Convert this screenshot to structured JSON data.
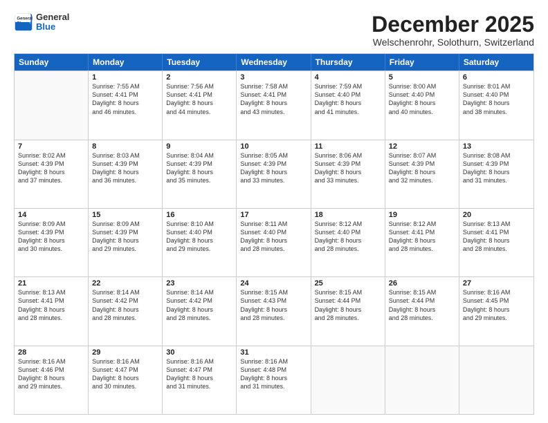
{
  "header": {
    "logo_general": "General",
    "logo_blue": "Blue",
    "month_title": "December 2025",
    "location": "Welschenrohr, Solothurn, Switzerland"
  },
  "weekdays": [
    "Sunday",
    "Monday",
    "Tuesday",
    "Wednesday",
    "Thursday",
    "Friday",
    "Saturday"
  ],
  "rows": [
    [
      {
        "day": "",
        "info": ""
      },
      {
        "day": "1",
        "info": "Sunrise: 7:55 AM\nSunset: 4:41 PM\nDaylight: 8 hours\nand 46 minutes."
      },
      {
        "day": "2",
        "info": "Sunrise: 7:56 AM\nSunset: 4:41 PM\nDaylight: 8 hours\nand 44 minutes."
      },
      {
        "day": "3",
        "info": "Sunrise: 7:58 AM\nSunset: 4:41 PM\nDaylight: 8 hours\nand 43 minutes."
      },
      {
        "day": "4",
        "info": "Sunrise: 7:59 AM\nSunset: 4:40 PM\nDaylight: 8 hours\nand 41 minutes."
      },
      {
        "day": "5",
        "info": "Sunrise: 8:00 AM\nSunset: 4:40 PM\nDaylight: 8 hours\nand 40 minutes."
      },
      {
        "day": "6",
        "info": "Sunrise: 8:01 AM\nSunset: 4:40 PM\nDaylight: 8 hours\nand 38 minutes."
      }
    ],
    [
      {
        "day": "7",
        "info": "Sunrise: 8:02 AM\nSunset: 4:39 PM\nDaylight: 8 hours\nand 37 minutes."
      },
      {
        "day": "8",
        "info": "Sunrise: 8:03 AM\nSunset: 4:39 PM\nDaylight: 8 hours\nand 36 minutes."
      },
      {
        "day": "9",
        "info": "Sunrise: 8:04 AM\nSunset: 4:39 PM\nDaylight: 8 hours\nand 35 minutes."
      },
      {
        "day": "10",
        "info": "Sunrise: 8:05 AM\nSunset: 4:39 PM\nDaylight: 8 hours\nand 33 minutes."
      },
      {
        "day": "11",
        "info": "Sunrise: 8:06 AM\nSunset: 4:39 PM\nDaylight: 8 hours\nand 33 minutes."
      },
      {
        "day": "12",
        "info": "Sunrise: 8:07 AM\nSunset: 4:39 PM\nDaylight: 8 hours\nand 32 minutes."
      },
      {
        "day": "13",
        "info": "Sunrise: 8:08 AM\nSunset: 4:39 PM\nDaylight: 8 hours\nand 31 minutes."
      }
    ],
    [
      {
        "day": "14",
        "info": "Sunrise: 8:09 AM\nSunset: 4:39 PM\nDaylight: 8 hours\nand 30 minutes."
      },
      {
        "day": "15",
        "info": "Sunrise: 8:09 AM\nSunset: 4:39 PM\nDaylight: 8 hours\nand 29 minutes."
      },
      {
        "day": "16",
        "info": "Sunrise: 8:10 AM\nSunset: 4:40 PM\nDaylight: 8 hours\nand 29 minutes."
      },
      {
        "day": "17",
        "info": "Sunrise: 8:11 AM\nSunset: 4:40 PM\nDaylight: 8 hours\nand 28 minutes."
      },
      {
        "day": "18",
        "info": "Sunrise: 8:12 AM\nSunset: 4:40 PM\nDaylight: 8 hours\nand 28 minutes."
      },
      {
        "day": "19",
        "info": "Sunrise: 8:12 AM\nSunset: 4:41 PM\nDaylight: 8 hours\nand 28 minutes."
      },
      {
        "day": "20",
        "info": "Sunrise: 8:13 AM\nSunset: 4:41 PM\nDaylight: 8 hours\nand 28 minutes."
      }
    ],
    [
      {
        "day": "21",
        "info": "Sunrise: 8:13 AM\nSunset: 4:41 PM\nDaylight: 8 hours\nand 28 minutes."
      },
      {
        "day": "22",
        "info": "Sunrise: 8:14 AM\nSunset: 4:42 PM\nDaylight: 8 hours\nand 28 minutes."
      },
      {
        "day": "23",
        "info": "Sunrise: 8:14 AM\nSunset: 4:42 PM\nDaylight: 8 hours\nand 28 minutes."
      },
      {
        "day": "24",
        "info": "Sunrise: 8:15 AM\nSunset: 4:43 PM\nDaylight: 8 hours\nand 28 minutes."
      },
      {
        "day": "25",
        "info": "Sunrise: 8:15 AM\nSunset: 4:44 PM\nDaylight: 8 hours\nand 28 minutes."
      },
      {
        "day": "26",
        "info": "Sunrise: 8:15 AM\nSunset: 4:44 PM\nDaylight: 8 hours\nand 28 minutes."
      },
      {
        "day": "27",
        "info": "Sunrise: 8:16 AM\nSunset: 4:45 PM\nDaylight: 8 hours\nand 29 minutes."
      }
    ],
    [
      {
        "day": "28",
        "info": "Sunrise: 8:16 AM\nSunset: 4:46 PM\nDaylight: 8 hours\nand 29 minutes."
      },
      {
        "day": "29",
        "info": "Sunrise: 8:16 AM\nSunset: 4:47 PM\nDaylight: 8 hours\nand 30 minutes."
      },
      {
        "day": "30",
        "info": "Sunrise: 8:16 AM\nSunset: 4:47 PM\nDaylight: 8 hours\nand 31 minutes."
      },
      {
        "day": "31",
        "info": "Sunrise: 8:16 AM\nSunset: 4:48 PM\nDaylight: 8 hours\nand 31 minutes."
      },
      {
        "day": "",
        "info": ""
      },
      {
        "day": "",
        "info": ""
      },
      {
        "day": "",
        "info": ""
      }
    ]
  ]
}
